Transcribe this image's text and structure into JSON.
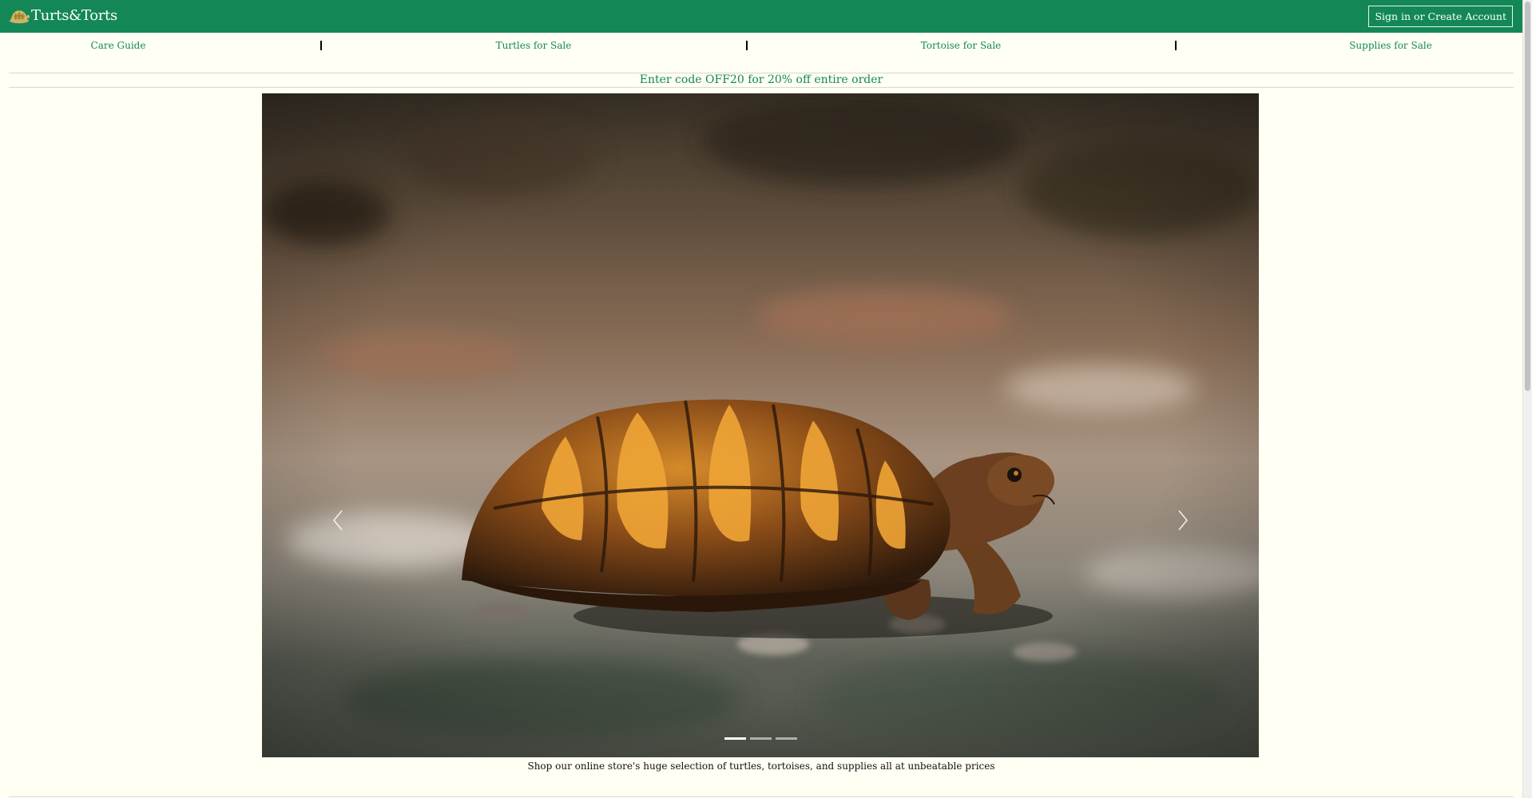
{
  "header": {
    "logo_icon": "turtle-icon",
    "brand": "Turts&Torts",
    "signin_label": "Sign in or Create Account",
    "brand_color": "#138856"
  },
  "nav": {
    "items": [
      {
        "label": "Care Guide"
      },
      {
        "label": "Turtles for Sale"
      },
      {
        "label": "Tortoise for Sale"
      },
      {
        "label": "Supplies for Sale"
      }
    ]
  },
  "promo": {
    "text": "Enter code OFF20 for 20% off entire order"
  },
  "carousel": {
    "prev_icon": "chevron-left-icon",
    "next_icon": "chevron-right-icon",
    "slide_count": 3,
    "active_slide": 1,
    "caption": "Shop our online store's huge selection of turtles, tortoises, and supplies all at unbeatable prices"
  }
}
